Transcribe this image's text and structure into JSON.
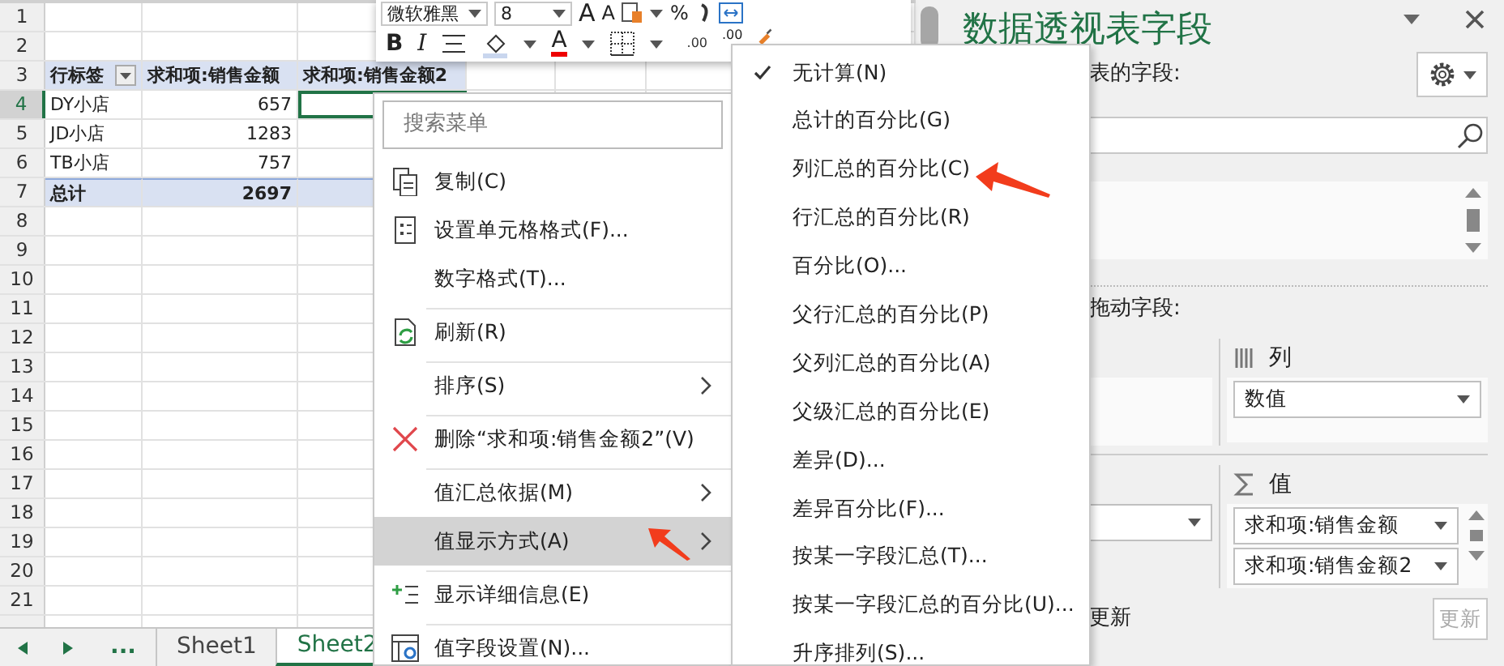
{
  "mini_toolbar": {
    "font_name": "微软雅黑",
    "font_size": "8",
    "row1": [
      {
        "kind": "grow",
        "label": "A"
      },
      {
        "kind": "shrink",
        "label": "A"
      },
      {
        "kind": "style"
      },
      {
        "kind": "caret"
      },
      {
        "kind": "text",
        "label": "%"
      },
      {
        "kind": "comma"
      },
      {
        "kind": "wrap"
      }
    ],
    "row2": [
      {
        "kind": "bold",
        "label": "B"
      },
      {
        "kind": "italic",
        "label": "I"
      },
      {
        "kind": "align"
      },
      {
        "kind": "fill"
      },
      {
        "kind": "caret"
      },
      {
        "kind": "fontcolor",
        "label": "A"
      },
      {
        "kind": "caret"
      },
      {
        "kind": "border"
      },
      {
        "kind": "caret"
      },
      {
        "kind": "decimal",
        "label": ".00"
      },
      {
        "kind": "text",
        "label": ".00"
      },
      {
        "kind": "brush"
      }
    ]
  },
  "sheet": {
    "row_numbers": [
      "1",
      "2",
      "3",
      "4",
      "5",
      "6",
      "7",
      "8",
      "9",
      "10",
      "11",
      "12",
      "13",
      "14",
      "15",
      "16",
      "17",
      "18",
      "19",
      "20",
      "21"
    ],
    "pivot": {
      "header": [
        "行标签",
        "求和项:销售金额",
        "求和项:销售金额2"
      ],
      "rows": [
        {
          "label": "DY小店",
          "value": "657"
        },
        {
          "label": "JD小店",
          "value": "1283"
        },
        {
          "label": "TB小店",
          "value": "757"
        }
      ],
      "total": {
        "label": "总计",
        "value": "2697"
      }
    }
  },
  "sheet_tabs": {
    "overflow": "...",
    "tabs": [
      {
        "label": "Sheet1",
        "selected": false
      },
      {
        "label": "Sheet2",
        "selected": true
      }
    ]
  },
  "context_menu": {
    "search_placeholder": "搜索菜单",
    "items": [
      {
        "label": "复制(C)",
        "kind": "copy",
        "separator_before": false,
        "has_submenu": false,
        "selected": false
      },
      {
        "label": "设置单元格格式(F)...",
        "kind": "format",
        "separator_before": false,
        "has_submenu": false,
        "selected": false
      },
      {
        "label": "数字格式(T)...",
        "kind": "plain",
        "separator_before": false,
        "has_submenu": false,
        "selected": false
      },
      {
        "label": "刷新(R)",
        "kind": "refresh",
        "separator_before": true,
        "has_submenu": false,
        "selected": false
      },
      {
        "label": "排序(S)",
        "kind": "plain",
        "separator_before": true,
        "has_submenu": true,
        "selected": false
      },
      {
        "label": "删除“求和项:销售金额2”(V)",
        "kind": "delete",
        "separator_before": true,
        "has_submenu": false,
        "selected": false
      },
      {
        "label": "值汇总依据(M)",
        "kind": "plain",
        "separator_before": true,
        "has_submenu": true,
        "selected": false
      },
      {
        "label": "值显示方式(A)",
        "kind": "plain",
        "separator_before": false,
        "has_submenu": true,
        "selected": true
      },
      {
        "label": "显示详细信息(E)",
        "kind": "details",
        "separator_before": true,
        "has_submenu": false,
        "selected": false
      },
      {
        "label": "值字段设置(N)...",
        "kind": "settings",
        "separator_before": true,
        "has_submenu": false,
        "selected": false
      }
    ]
  },
  "submenu": {
    "items": [
      {
        "label": "无计算(N)",
        "checked": true
      },
      {
        "label": "总计的百分比(G)",
        "checked": false
      },
      {
        "label": "列汇总的百分比(C)",
        "checked": false
      },
      {
        "label": "行汇总的百分比(R)",
        "checked": false
      },
      {
        "label": "百分比(O)...",
        "checked": false
      },
      {
        "label": "父行汇总的百分比(P)",
        "checked": false
      },
      {
        "label": "父列汇总的百分比(A)",
        "checked": false
      },
      {
        "label": "父级汇总的百分比(E)",
        "checked": false
      },
      {
        "label": "差异(D)...",
        "checked": false
      },
      {
        "label": "差异百分比(F)...",
        "checked": false
      },
      {
        "label": "按某一字段汇总(T)...",
        "checked": false
      },
      {
        "label": "按某一字段汇总的百分比(U)...",
        "checked": false
      },
      {
        "label": "升序排列(S)...",
        "checked": false
      }
    ]
  },
  "field_pane": {
    "title": "数据透视表字段",
    "fields_caption": "表的字段:",
    "drag_caption": "拖动字段:",
    "columns_area": {
      "title": "列",
      "fields": [
        "数值"
      ]
    },
    "values_area": {
      "title": "值",
      "fields": [
        "求和项:销售金额",
        "求和项:销售金额2"
      ]
    },
    "defer_caption": "更新",
    "update_button": {
      "label": "更新",
      "disabled": true
    }
  }
}
